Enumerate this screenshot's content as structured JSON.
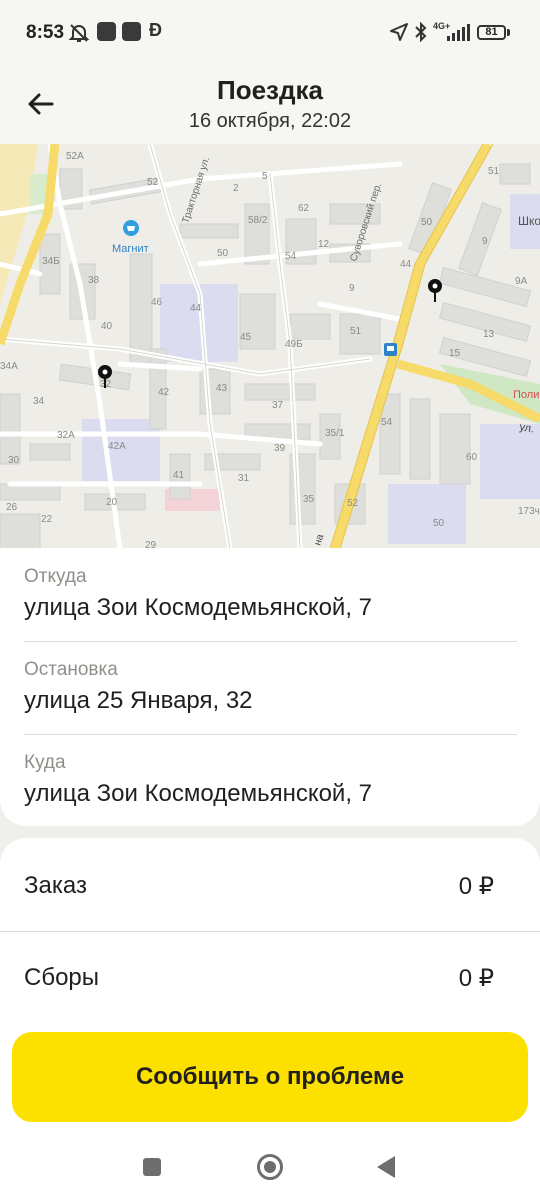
{
  "status_bar": {
    "time": "8:53",
    "network": "4G+",
    "battery": "81",
    "icons": [
      "mute-icon",
      "app-notification-icon",
      "app-notification-icon",
      "d-app-icon",
      "location-arrow-icon",
      "bluetooth-icon",
      "signal-icon",
      "battery-icon"
    ]
  },
  "header": {
    "title": "Поездка",
    "subtitle": "16 октября, 22:02",
    "back_icon": "arrow-left-icon"
  },
  "map": {
    "labels": {
      "l52a": "52A",
      "l52": "52",
      "l5": "5",
      "l2": "2",
      "l62": "62",
      "l58_2": "58/2",
      "l50": "50",
      "l54": "54",
      "l12": "12",
      "l9": "9",
      "l34b": "34Б",
      "l38": "38",
      "l46": "46",
      "l44": "44",
      "l40": "40",
      "l45": "45",
      "l49b": "49Б",
      "l51": "51",
      "l42": "42",
      "l43": "43",
      "l37": "37",
      "l34": "34",
      "l32a": "32A",
      "l42a": "42A",
      "l39": "39",
      "l35_1": "35/1",
      "l30": "30",
      "l41": "41",
      "l31": "31",
      "l20": "20",
      "l35": "35",
      "l26": "26",
      "l22": "22",
      "l29": "29",
      "l52b": "52",
      "l50b": "50",
      "l54b": "54",
      "l60": "60",
      "l173": "173ч",
      "l44b": "44",
      "l13": "13",
      "l15": "15",
      "l9a": "9A",
      "l9b": "9",
      "l51b": "51",
      "l50c": "50",
      "l34a": "34A",
      "l32": "32"
    },
    "streets": {
      "traktornaya": "Тракторная ул.",
      "suvorovsky": "Суворовский пер.",
      "ul": "ул.",
      "na": "на"
    },
    "poi": {
      "magnit": "Магнит",
      "shk": "Шко",
      "poli": "Поли"
    }
  },
  "trip": {
    "from_label": "Откуда",
    "from_value": "улица Зои Космодемьянской, 7",
    "stop_label": "Остановка",
    "stop_value": "улица 25 Января, 32",
    "to_label": "Куда",
    "to_value": "улица Зои Космодемьянской, 7"
  },
  "prices": {
    "order_label": "Заказ",
    "order_value": "0 ₽",
    "fees_label": "Сборы",
    "fees_value": "0 ₽"
  },
  "actions": {
    "report_label": "Сообщить о проблеме"
  },
  "colors": {
    "accent": "#fce000",
    "road_major": "#f7db6a",
    "building": "#dededa"
  }
}
